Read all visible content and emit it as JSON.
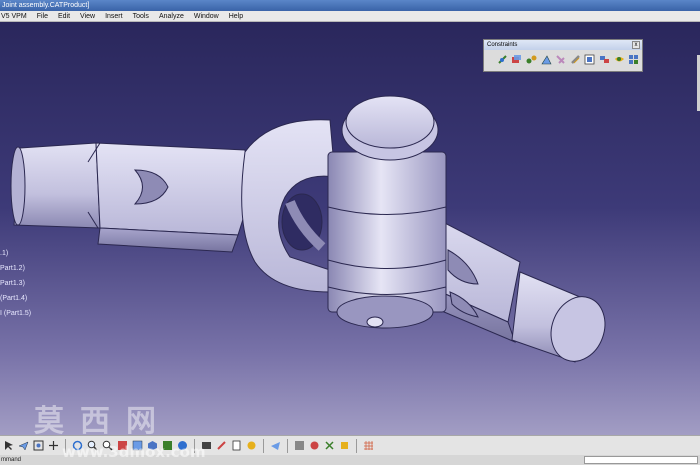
{
  "window": {
    "title": "Joint assembly.CATProduct]"
  },
  "menu": [
    "V5 VPM",
    "File",
    "Edit",
    "View",
    "Insert",
    "Tools",
    "Analyze",
    "Window",
    "Help"
  ],
  "tree": {
    "items": [
      ".1)",
      "Part1.2)",
      "Part1.3)",
      "(Part1.4)",
      "I (Part1.5)"
    ]
  },
  "constraints_toolbar": {
    "title": "Constraints",
    "close_label": "x",
    "icons": [
      "coincidence-constraint-icon",
      "contact-constraint-icon",
      "offset-constraint-icon",
      "angle-constraint-icon",
      "fix-component-icon",
      "fix-together-icon",
      "quick-constraint-icon",
      "flexible-subassembly-icon",
      "change-constraint-icon",
      "reuse-pattern-icon"
    ]
  },
  "bottom_toolbar": {
    "icons": [
      "select-icon",
      "fly-mode-icon",
      "fit-all-icon",
      "pan-icon",
      "rotate-icon",
      "zoom-in-icon",
      "zoom-out-icon",
      "normal-view-icon",
      "multi-view-icon",
      "iso-view-icon",
      "shading-icon",
      "hide-show-icon",
      "swap-space-icon",
      "update-icon",
      "catalog-icon",
      "measure-icon",
      "analyze-icon",
      "manipulate-icon",
      "snap-icon",
      "explode-icon",
      "scene-icon",
      "grid-icon"
    ]
  },
  "status": {
    "text": "mmand"
  },
  "watermark": {
    "cn": "莫西网",
    "url": "www.3dmox.com"
  },
  "colors": {
    "background_top": "#2a275c",
    "background_bottom": "#a29dc4",
    "part": "#c8c6e2",
    "part_shadow": "#7d7aa6"
  }
}
